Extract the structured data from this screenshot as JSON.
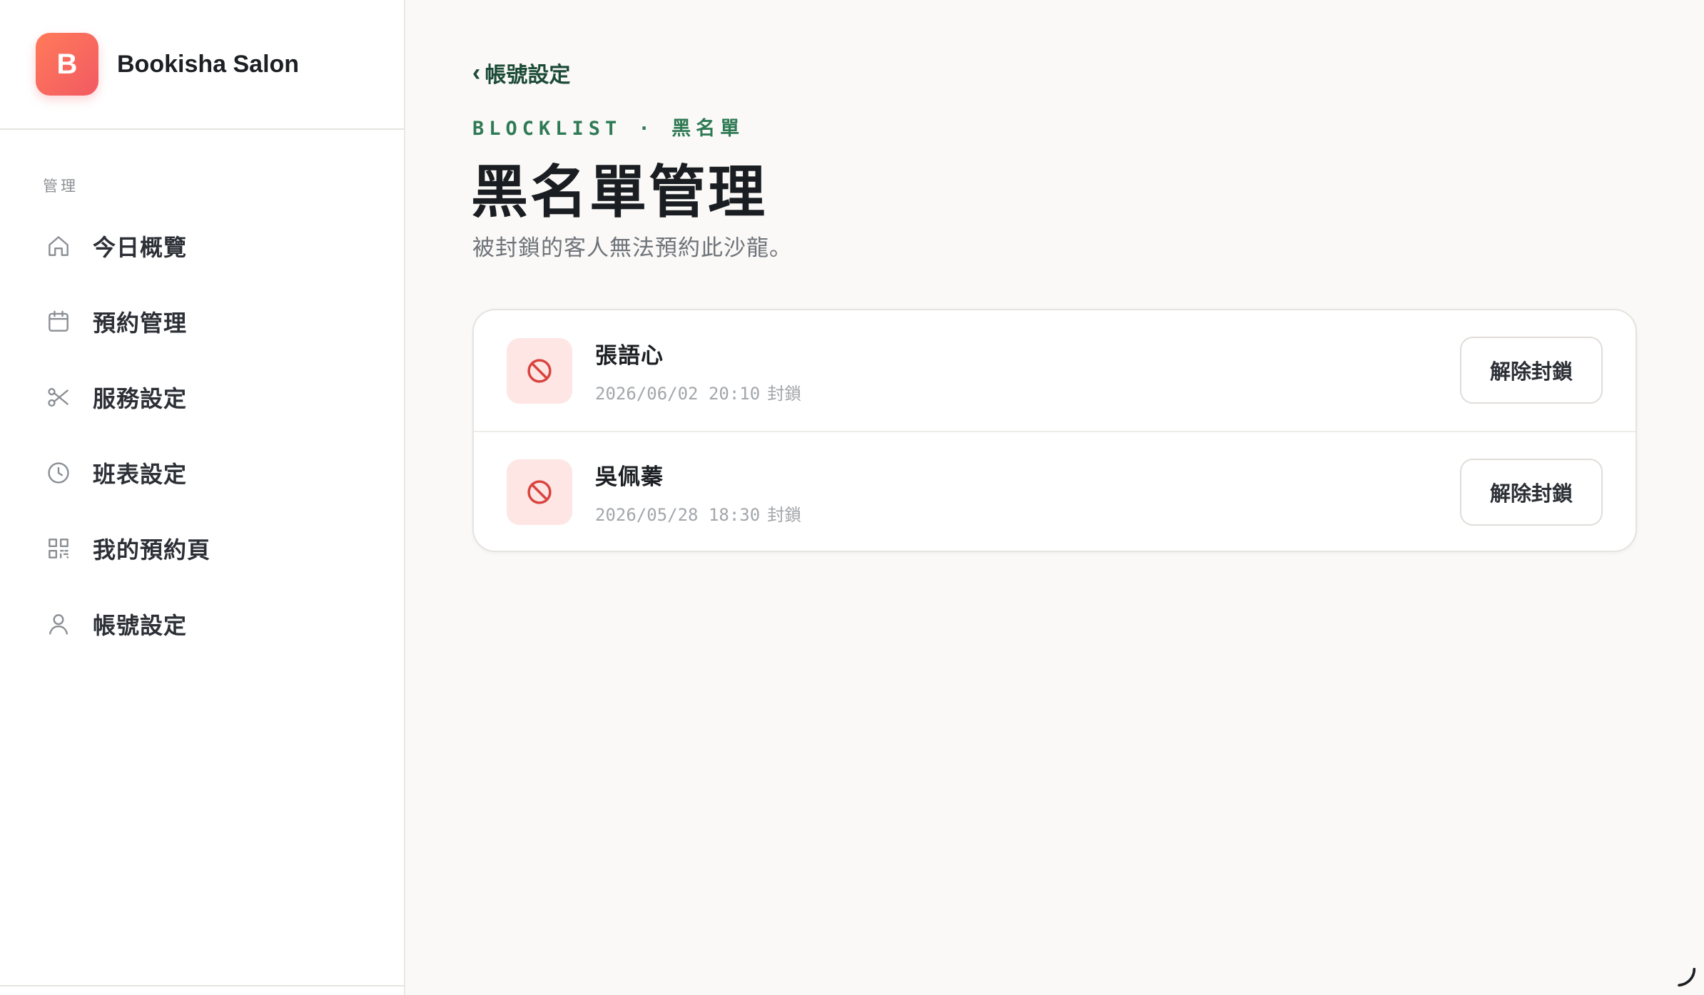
{
  "brand": {
    "logo_letter": "B",
    "name": "Bookisha Salon",
    "accent": "#f25a63"
  },
  "sidebar": {
    "section_label": "管理",
    "items": [
      {
        "label": "今日概覽",
        "icon": "home-icon"
      },
      {
        "label": "預約管理",
        "icon": "calendar-icon"
      },
      {
        "label": "服務設定",
        "icon": "scissors-icon"
      },
      {
        "label": "班表設定",
        "icon": "clock-icon"
      },
      {
        "label": "我的預約頁",
        "icon": "qr-code-icon"
      },
      {
        "label": "帳號設定",
        "icon": "user-icon"
      }
    ]
  },
  "main": {
    "back_label": "帳號設定",
    "eyebrow": "BLOCKLIST · 黑名單",
    "title": "黑名單管理",
    "subtitle": "被封鎖的客人無法預約此沙龍。",
    "blocked": [
      {
        "name": "張語心",
        "datetime": "2026/06/02 20:10",
        "status": "封鎖",
        "action": "解除封鎖"
      },
      {
        "name": "吳佩蓁",
        "datetime": "2026/05/28 18:30",
        "status": "封鎖",
        "action": "解除封鎖"
      }
    ]
  },
  "colors": {
    "primary_green": "#1b4a36",
    "eyebrow_green": "#2f7a55",
    "ban_red": "#d9443f",
    "ban_bg": "#fde6e4"
  }
}
